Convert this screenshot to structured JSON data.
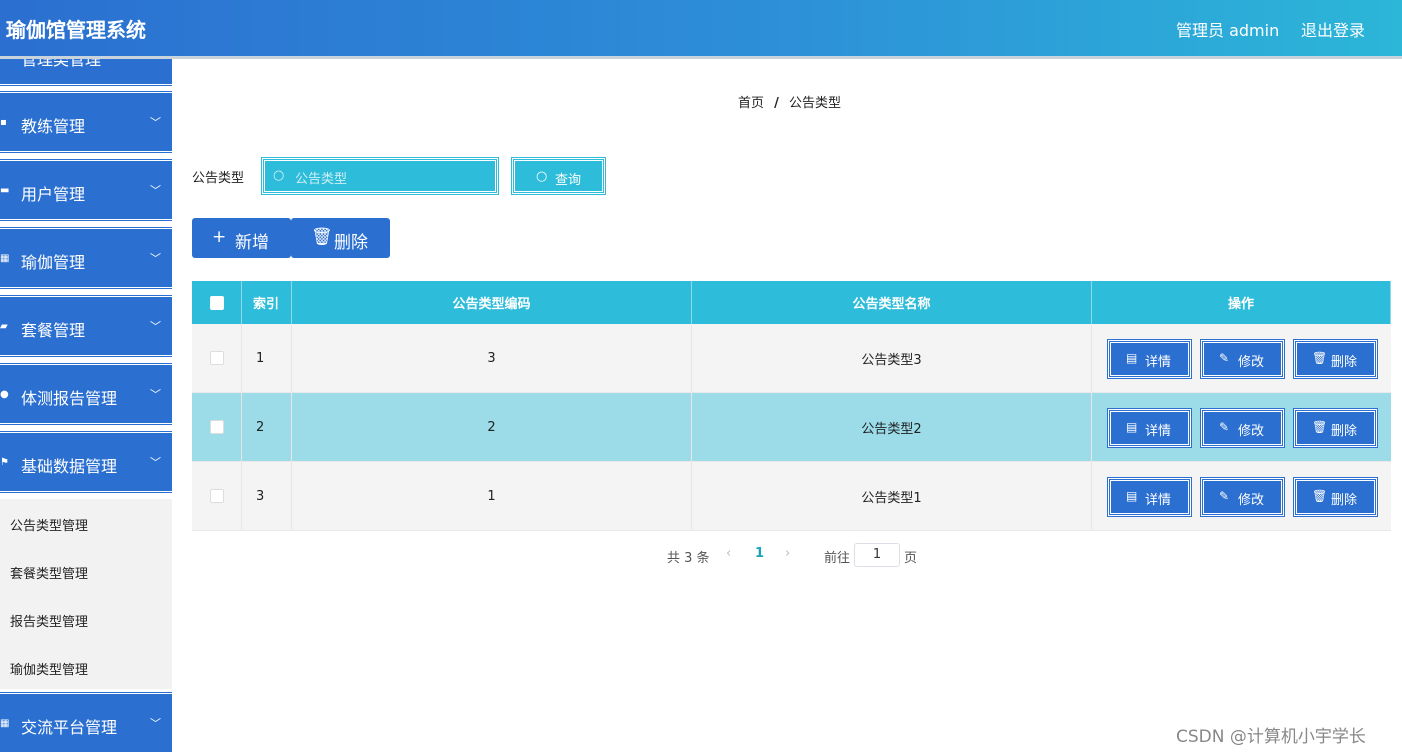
{
  "header": {
    "title": "瑜伽馆管理系统",
    "user": "管理员 admin",
    "logout": "退出登录"
  },
  "sidebar": {
    "partial_item": "管理类管理",
    "items": [
      {
        "label": "教练管理",
        "icon": "briefcase-icon"
      },
      {
        "label": "用户管理",
        "icon": "monitor-icon"
      },
      {
        "label": "瑜伽管理",
        "icon": "grid-icon"
      },
      {
        "label": "套餐管理",
        "icon": "chat-icon"
      },
      {
        "label": "体测报告管理",
        "icon": "person-icon"
      },
      {
        "label": "基础数据管理",
        "icon": "flag-icon"
      }
    ],
    "submenu": [
      "公告类型管理",
      "套餐类型管理",
      "报告类型管理",
      "瑜伽类型管理"
    ],
    "last_item": {
      "label": "交流平台管理",
      "icon": "grid-icon"
    }
  },
  "breadcrumb": {
    "home": "首页",
    "separator": "/",
    "current": "公告类型"
  },
  "search": {
    "label": "公告类型",
    "placeholder": "公告类型",
    "button": "查询"
  },
  "actions": {
    "add": "新增",
    "delete": "删除"
  },
  "table": {
    "columns": [
      "索引",
      "公告类型编码",
      "公告类型名称",
      "操作"
    ],
    "rows": [
      {
        "index": "1",
        "code": "3",
        "name": "公告类型3"
      },
      {
        "index": "2",
        "code": "2",
        "name": "公告类型2"
      },
      {
        "index": "3",
        "code": "1",
        "name": "公告类型1"
      }
    ],
    "row_actions": {
      "detail": "详情",
      "edit": "修改",
      "delete": "删除"
    }
  },
  "pagination": {
    "total": "共 3 条",
    "current_page": "1",
    "goto_label": "前往",
    "goto_value": "1",
    "page_suffix": "页"
  },
  "watermark": "CSDN @计算机小宇学长",
  "colors": {
    "primary": "#2b6fd0",
    "accent": "#2dbcd9",
    "row_highlight": "#9bdce8"
  }
}
